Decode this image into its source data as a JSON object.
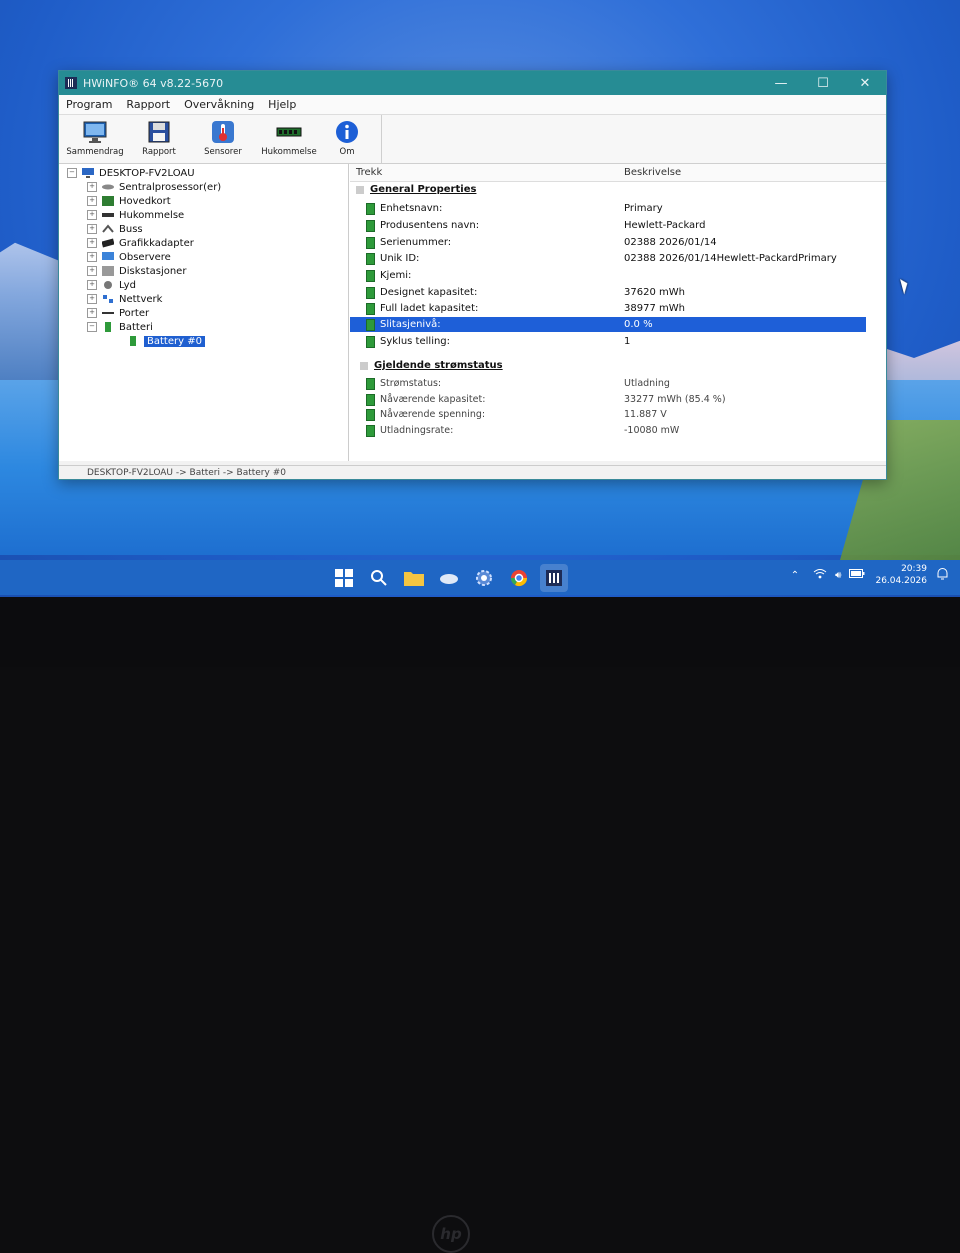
{
  "window": {
    "title": "HWiNFO® 64 v8.22-5670",
    "controls": {
      "minimize": "—",
      "maximize": "☐",
      "close": "✕"
    }
  },
  "menu": [
    "Program",
    "Rapport",
    "Overvåkning",
    "Hjelp"
  ],
  "toolbar": [
    {
      "label": "Sammendrag",
      "icon": "monitor-icon"
    },
    {
      "label": "Rapport",
      "icon": "floppy-disk-icon"
    },
    {
      "label": "Sensorer",
      "icon": "thermometer-icon"
    },
    {
      "label": "Hukommelse",
      "icon": "memory-module-icon"
    },
    {
      "label": "Om",
      "icon": "info-icon"
    }
  ],
  "tree": {
    "root": "DESKTOP-FV2LOAU",
    "items": [
      "Sentralprosessor(er)",
      "Hovedkort",
      "Hukommelse",
      "Buss",
      "Grafikkadapter",
      "Observere",
      "Diskstasjoner",
      "Lyd",
      "Nettverk",
      "Porter",
      "Batteri"
    ],
    "selected": "Battery #0"
  },
  "details": {
    "columns": {
      "feature": "Trekk",
      "description": "Beskrivelse"
    },
    "section1": "General Properties",
    "rows1": [
      {
        "label": "Enhetsnavn:",
        "value": "Primary"
      },
      {
        "label": "Produsentens navn:",
        "value": "Hewlett-Packard"
      },
      {
        "label": "Serienummer:",
        "value": "02388 2026/01/14"
      },
      {
        "label": "Unik ID:",
        "value": "02388 2026/01/14Hewlett-PackardPrimary"
      },
      {
        "label": "Kjemi:",
        "value": ""
      },
      {
        "label": "Designet kapasitet:",
        "value": "37620 mWh"
      },
      {
        "label": "Full ladet kapasitet:",
        "value": "38977 mWh"
      },
      {
        "label": "Slitasjenivå:",
        "value": "0.0 %"
      },
      {
        "label": "Syklus telling:",
        "value": "1"
      }
    ],
    "section2": "Gjeldende strømstatus",
    "rows2": [
      {
        "label": "Strømstatus:",
        "value": "Utladning"
      },
      {
        "label": "Nåværende kapasitet:",
        "value": "33277 mWh (85.4 %)"
      },
      {
        "label": "Nåværende spenning:",
        "value": "11.887 V"
      },
      {
        "label": "Utladningsrate:",
        "value": "-10080 mW"
      }
    ]
  },
  "status": "DESKTOP-FV2LOAU -> Batteri -> Battery #0",
  "taskbar": {
    "time": "20:39",
    "date": "26.04.2026"
  },
  "colors": {
    "titlebar": "#268c94",
    "selection": "#1e5fd8",
    "taskbar": "#1f66c4"
  }
}
